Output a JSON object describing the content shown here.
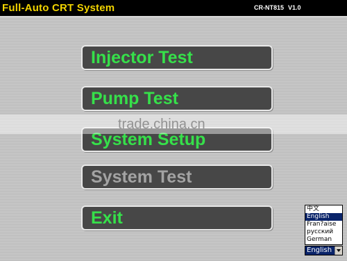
{
  "header": {
    "title": "Full-Auto CRT System",
    "model": "CR-NT815",
    "version": "V1.0"
  },
  "menu": {
    "items": [
      {
        "label": "Injector Test"
      },
      {
        "label": "Pump Test"
      },
      {
        "label": "System Setup"
      },
      {
        "label": "System Test"
      },
      {
        "label": "Exit"
      }
    ]
  },
  "watermark": "trade.china.cn",
  "language": {
    "options": [
      "中文",
      "English",
      "Fran?aise",
      "русский",
      "German"
    ],
    "selected": "English"
  },
  "colors": {
    "title": "#f2d400",
    "button_text": "#36e04a",
    "disabled_text": "#a3a3a3",
    "button_bg": "#474747"
  }
}
